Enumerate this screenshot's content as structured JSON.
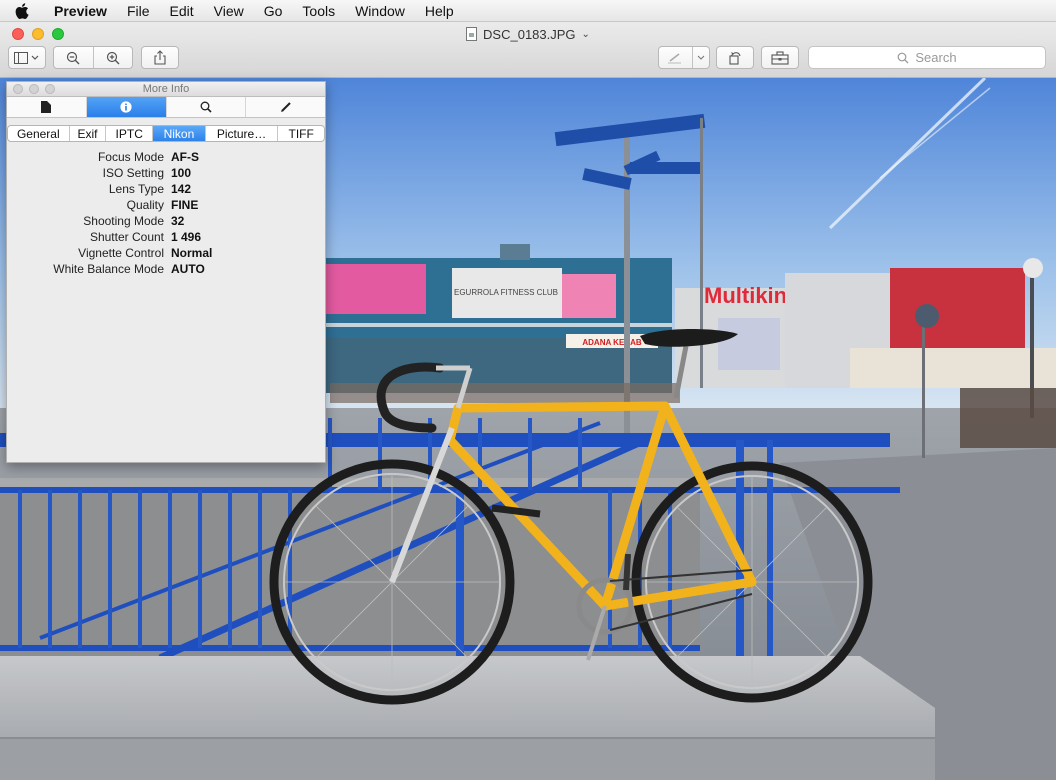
{
  "menubar": {
    "app_name": "Preview",
    "items": [
      "File",
      "Edit",
      "View",
      "Go",
      "Tools",
      "Window",
      "Help"
    ]
  },
  "window": {
    "title": "DSC_0183.JPG",
    "search_placeholder": "Search"
  },
  "inspector": {
    "title": "More Info",
    "tab_icons": [
      "document-icon",
      "info-icon",
      "magnifier-icon",
      "pencil-icon"
    ],
    "active_tab": 1,
    "sub_tabs": [
      "General",
      "Exif",
      "IPTC",
      "Nikon",
      "Picture…",
      "TIFF"
    ],
    "active_sub_tab": 3,
    "properties": [
      {
        "key": "Focus Mode",
        "value": "AF-S"
      },
      {
        "key": "ISO Setting",
        "value": "100"
      },
      {
        "key": "Lens Type",
        "value": "142"
      },
      {
        "key": "Quality",
        "value": "FINE"
      },
      {
        "key": "Shooting Mode",
        "value": "32"
      },
      {
        "key": "Shutter Count",
        "value": "1 496"
      },
      {
        "key": "Vignette Control",
        "value": "Normal"
      },
      {
        "key": "White Balance Mode",
        "value": "AUTO"
      }
    ]
  },
  "photo_signs": {
    "left_billboard": "EGURROLA FITNESS CLUB",
    "building_sign": "Multikino",
    "banner": "ADANA KEBAB"
  },
  "colors": {
    "accent": "#2a7fe9",
    "bike_frame": "#f2b21c",
    "railing": "#1f4fbf"
  }
}
